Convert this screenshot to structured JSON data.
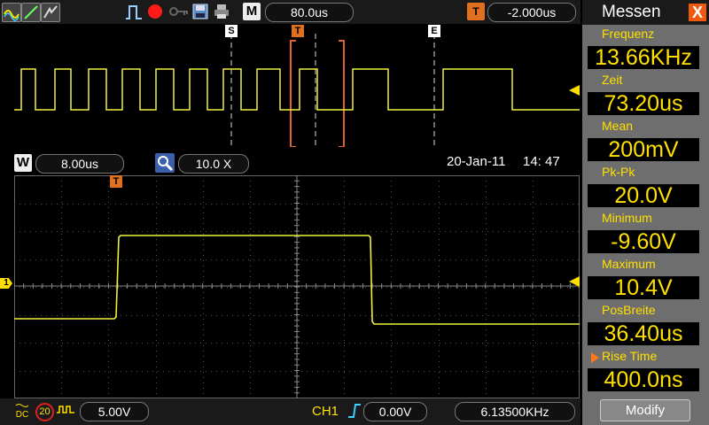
{
  "top_bar": {
    "mode_badge": "M",
    "timebase": "80.0us",
    "trigger_badge": "T",
    "trigger_position": "-2.000us"
  },
  "overview": {
    "markers": {
      "start": "S",
      "trigger": "T",
      "end": "E"
    }
  },
  "mid_bar": {
    "window_badge": "W",
    "window_timebase": "8.00us",
    "zoom_factor": "10.0  X",
    "date": "20-Jan-11",
    "time": "14: 47"
  },
  "scope": {
    "trigger_marker": "T",
    "channel_marker": "1"
  },
  "bottom_bar": {
    "coupling": "DC",
    "bw_limit": "20",
    "volts_div": "5.00V",
    "trigger_source": "CH1",
    "trigger_level": "0.00V",
    "frequency": "6.13500KHz"
  },
  "panel": {
    "title": "Messen",
    "close": "X",
    "measurements": [
      {
        "label": "Frequenz",
        "value": "13.66KHz"
      },
      {
        "label": "Zeit",
        "value": "73.20us"
      },
      {
        "label": "Mean",
        "value": "200mV"
      },
      {
        "label": "Pk-Pk",
        "value": "20.0V"
      },
      {
        "label": "Minimum",
        "value": "-9.60V"
      },
      {
        "label": "Maximum",
        "value": "10.4V"
      },
      {
        "label": "PosBreite",
        "value": "36.40us"
      },
      {
        "label": "Rise  Time",
        "value": "400.0ns",
        "selected": true
      }
    ],
    "modify_button": "Modify"
  },
  "colors": {
    "trace": "#f0f040",
    "accent": "#e07020",
    "value_text": "#ffe000",
    "panel_bg": "#6e6e6e"
  },
  "icons": [
    "math-icon",
    "ref-icon",
    "save-icon",
    "run-icon",
    "stop-icon",
    "key-icon",
    "disk-icon",
    "print-icon"
  ]
}
